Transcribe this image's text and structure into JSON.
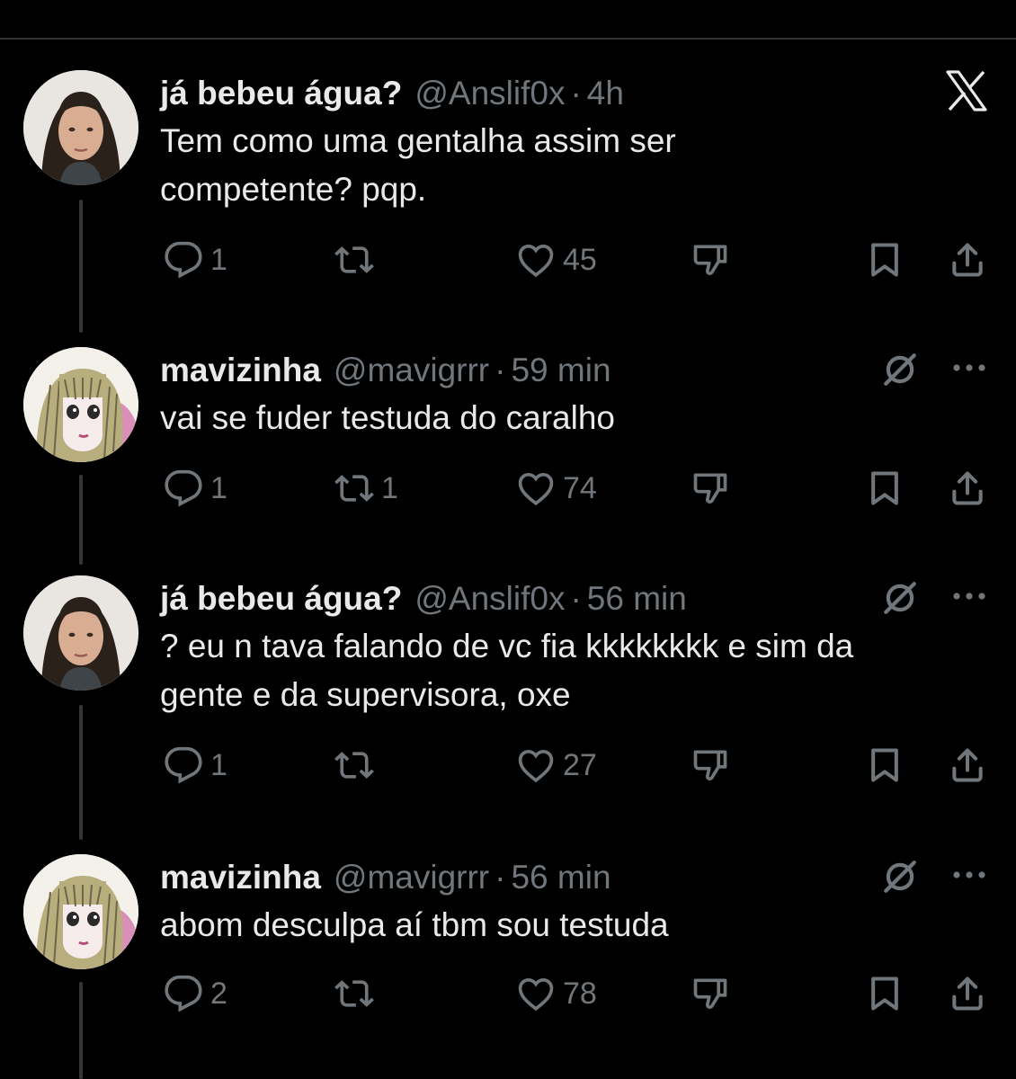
{
  "icons": {
    "x_logo": "x-logo-icon",
    "grok": "grok-icon",
    "more": "more-icon",
    "reply": "reply-icon",
    "repost": "repost-icon",
    "like": "heart-icon",
    "dislike": "dislike-icon",
    "bookmark": "bookmark-icon",
    "share": "share-icon"
  },
  "colors": {
    "background": "#000000",
    "text": "#e7e9ea",
    "muted": "#71767b",
    "thread_line": "#333639"
  },
  "posts": [
    {
      "display_name": "já bebeu água?",
      "handle": "@Anslif0x",
      "separator": "·",
      "time": "4h",
      "text_lines": [
        "Tem como uma gentalha assim ser",
        "competente? pqp."
      ],
      "reply_count": "1",
      "repost_count": "",
      "like_count": "45"
    },
    {
      "display_name": "mavizinha",
      "handle": "@mavigrrr",
      "separator": "·",
      "time": "59 min",
      "text_lines": [
        "vai se fuder testuda do caralho"
      ],
      "reply_count": "1",
      "repost_count": "1",
      "like_count": "74"
    },
    {
      "display_name": "já bebeu água?",
      "handle": "@Anslif0x",
      "separator": "·",
      "time": "56 min",
      "text_lines": [
        "? eu n tava falando de vc fia kkkkkkkk e sim da",
        "gente e da supervisora, oxe"
      ],
      "reply_count": "1",
      "repost_count": "",
      "like_count": "27"
    },
    {
      "display_name": "mavizinha",
      "handle": "@mavigrrr",
      "separator": "·",
      "time": "56 min",
      "text_lines": [
        "abom desculpa aí tbm sou testuda"
      ],
      "reply_count": "2",
      "repost_count": "",
      "like_count": "78"
    }
  ]
}
